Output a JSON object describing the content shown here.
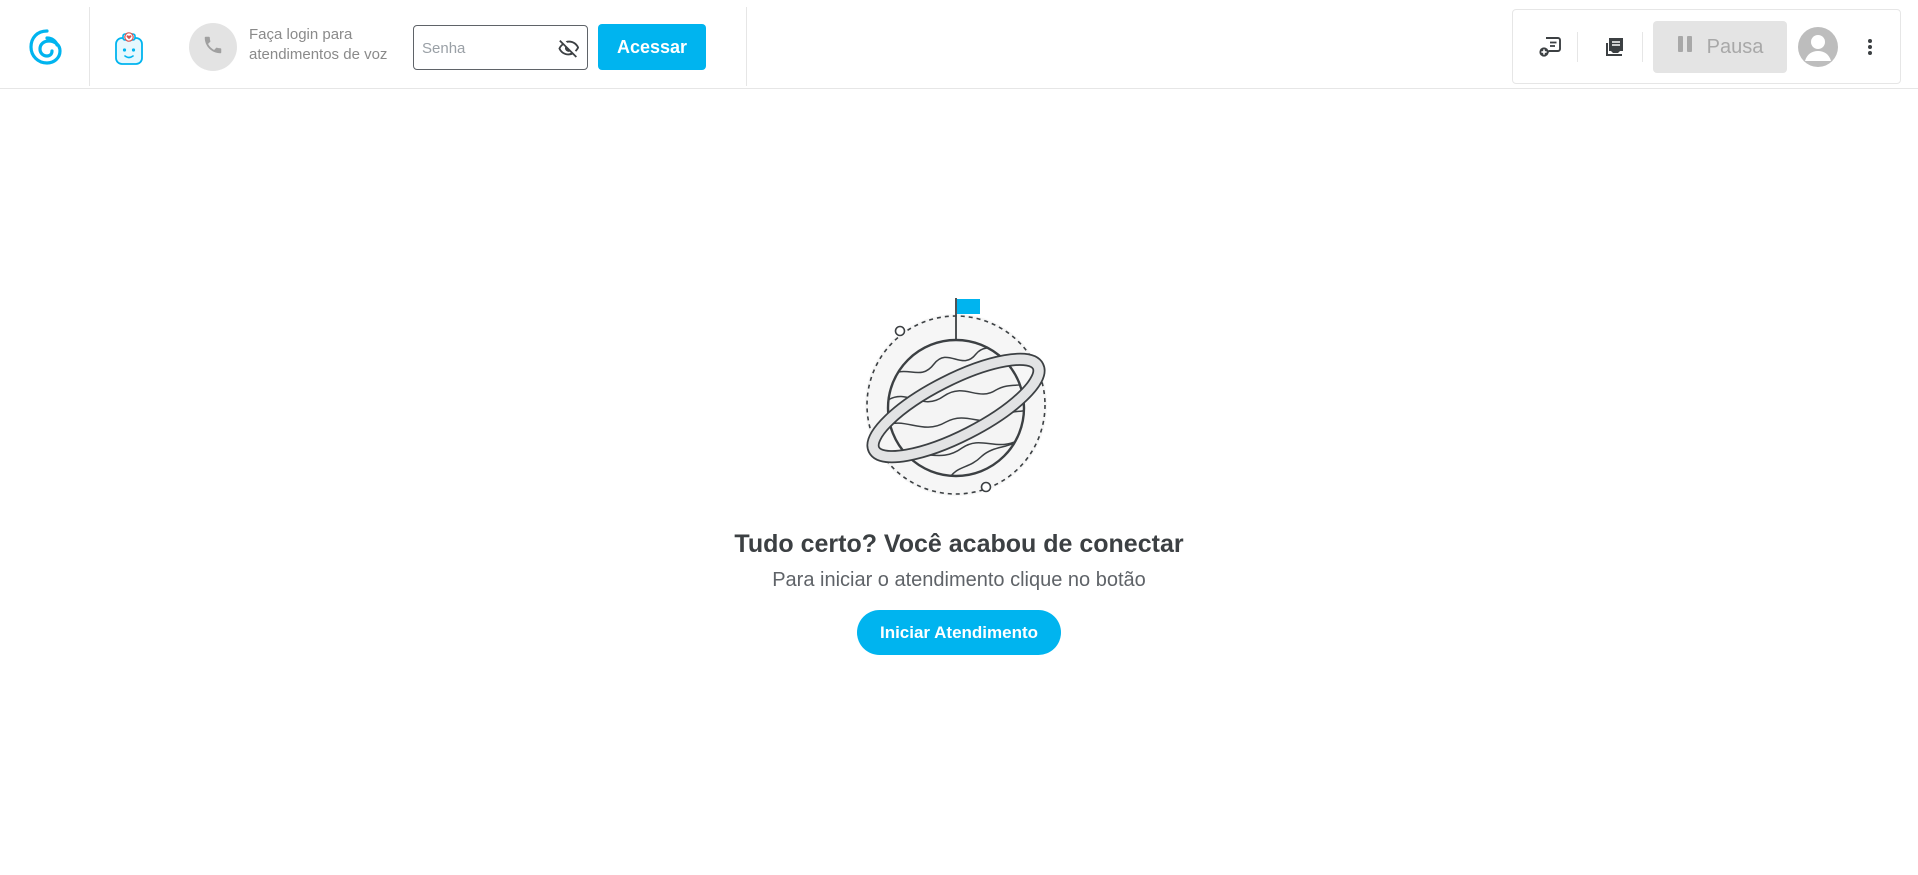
{
  "header": {
    "logo": "spiral-logo-icon",
    "app_icon": "health-robot-icon",
    "voice_login": {
      "icon": "phone-icon",
      "label": "Faça login para atendimentos de voz"
    },
    "password": {
      "placeholder": "Senha",
      "value": "",
      "toggle_icon": "eye-off-icon"
    },
    "submit_label": "Acessar"
  },
  "toolbar": {
    "new_chat_icon": "chat-add-icon",
    "inbox_icon": "inbox-icon",
    "pause_label": "Pausa",
    "pause_icon": "pause-icon",
    "avatar_icon": "user-avatar-icon",
    "more_icon": "more-vertical-icon"
  },
  "empty_state": {
    "illustration": "planet-flag-illustration",
    "title": "Tudo certo? Você acabou de conectar",
    "subtitle": "Para iniciar o atendimento clique no botão",
    "button_label": "Iniciar Atendimento"
  },
  "colors": {
    "accent": "#00b4ef",
    "text_dark": "#3c4043",
    "text_muted": "#8a8a8a",
    "disabled_bg": "#e4e4e4"
  }
}
